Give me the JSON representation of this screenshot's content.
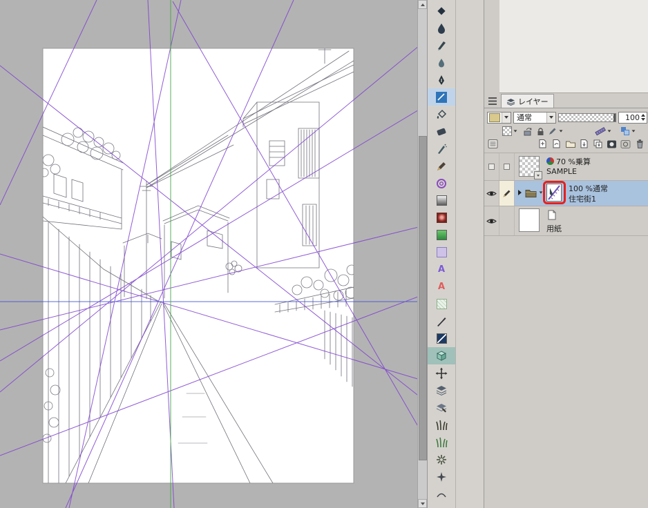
{
  "colors": {
    "selection_blue": "#a9c2de",
    "annotation_red": "#e5201d",
    "guide_purple": "#7d3fd0",
    "guide_blue": "#3f51d9",
    "guide_green": "#3f9e3f",
    "tool_selected_blue_bg": "#bfd4ea",
    "tool_selected_teal_bg": "#9fc1ba"
  },
  "toolbar": {
    "selected_tools": [
      "blue-pen-tool",
      "cube-3d-tool"
    ],
    "tools": [
      "operation-tool",
      "blend-drop-tool",
      "marker-tool",
      "watercolor-tool",
      "pen-nib-tool",
      "blue-pen-tool",
      "fill-bucket-tool",
      "eraser-tool",
      "airbrush-tool",
      "pencil-tool",
      "decoration-spiral-tool",
      "gradient-gray-tool",
      "gradient-red-tool",
      "green-swatch-tool",
      "purple-swatch-tool",
      "text-tool-purple",
      "text-tool-red",
      "sketch-swatch-tool",
      "brush-stroke-tool",
      "navy-swatch-tool",
      "cube-3d-tool",
      "move-tool",
      "layer-stack-tool",
      "layer-stack-alt-tool",
      "grass-dark-tool",
      "grass-green-tool",
      "flower-tool",
      "sparkle-tool",
      "partial-bottom-tool"
    ]
  },
  "layers_panel": {
    "tab_label": "レイヤー",
    "blend_mode": "通常",
    "opacity_value": "100",
    "palette_buttons": [
      "transparent-pixel-lock",
      "clip-to-layer-below",
      "lock-layer",
      "draft-layer",
      "ruler-settings",
      "layer-color"
    ],
    "command_buttons": [
      "new-raster-layer",
      "new-vector-layer",
      "new-layer-folder",
      "transfer-to-lower-layer",
      "merge-with-lower-layer",
      "create-layer-mask",
      "apply-layer-mask",
      "delete-layer"
    ],
    "rows": [
      {
        "info": "70 %乗算",
        "name": "SAMPLE",
        "selected": false,
        "visible": false
      },
      {
        "info": "100 %通常",
        "name": "住宅街1",
        "selected": true,
        "visible": true,
        "type": "folder",
        "has_ruler": true
      },
      {
        "info": "",
        "name": "用紙",
        "selected": false,
        "visible": true
      }
    ],
    "annotation": {
      "color": "#e5201d",
      "target": "perspective-ruler-icon"
    }
  }
}
